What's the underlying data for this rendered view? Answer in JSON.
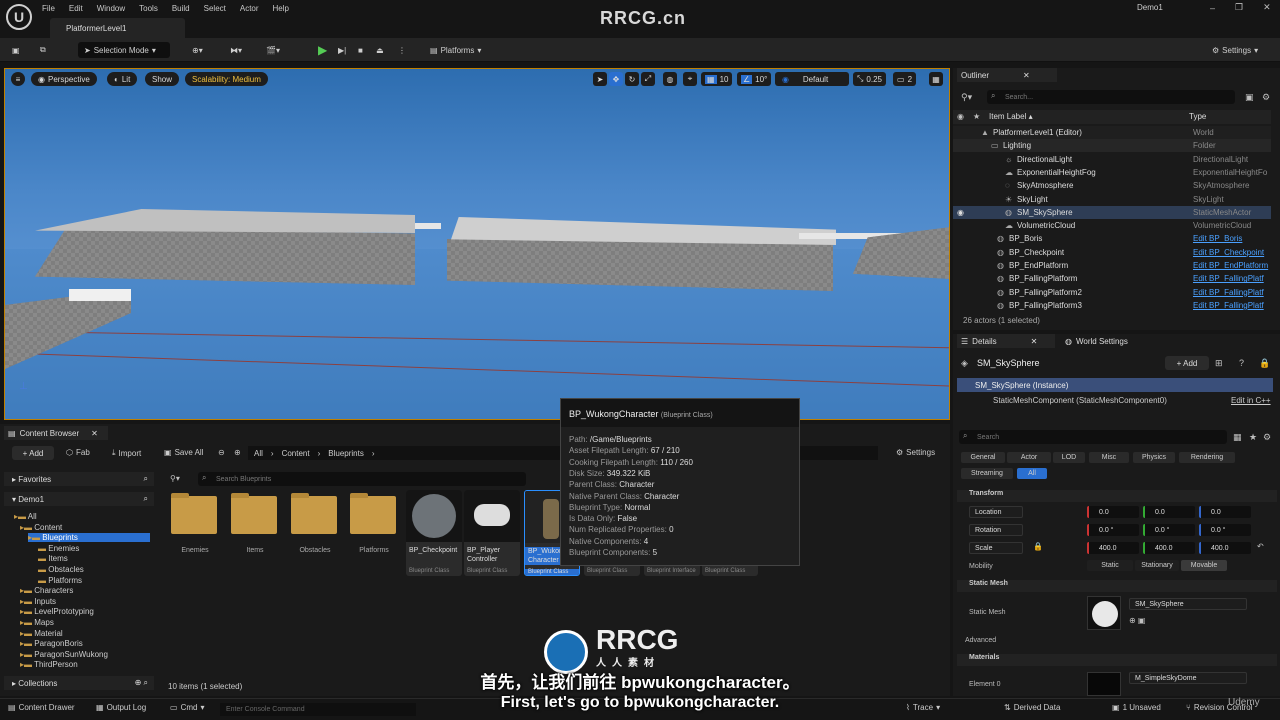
{
  "app": {
    "menu": [
      "File",
      "Edit",
      "Window",
      "Tools",
      "Build",
      "Select",
      "Actor",
      "Help"
    ],
    "level_tab": "PlatformerLevel1",
    "project": "Demo1",
    "logo_icon": "unreal-logo-icon"
  },
  "toolbar": {
    "selection_mode": "Selection Mode",
    "platforms": "Platforms",
    "settings": "Settings"
  },
  "viewport": {
    "perspective": "Perspective",
    "lit": "Lit",
    "show": "Show",
    "scalability": "Scalability: Medium",
    "grid": "10",
    "angle": "10°",
    "default": "Default",
    "scale": "0.25",
    "cam": "2"
  },
  "outliner": {
    "title": "Outliner",
    "search_placeholder": "Search...",
    "col_label": "Item Label ▴",
    "col_type": "Type",
    "rows": [
      {
        "label": "PlatformerLevel1 (Editor)",
        "type": "World",
        "link": false
      },
      {
        "label": "Lighting",
        "type": "Folder",
        "link": false
      },
      {
        "label": "DirectionalLight",
        "type": "DirectionalLight",
        "link": false
      },
      {
        "label": "ExponentialHeightFog",
        "type": "ExponentialHeightFo",
        "link": false
      },
      {
        "label": "SkyAtmosphere",
        "type": "SkyAtmosphere",
        "link": false
      },
      {
        "label": "SkyLight",
        "type": "SkyLight",
        "link": false
      },
      {
        "label": "SM_SkySphere",
        "type": "StaticMeshActor",
        "link": false
      },
      {
        "label": "VolumetricCloud",
        "type": "VolumetricCloud",
        "link": false
      },
      {
        "label": "BP_Boris",
        "type": "Edit BP_Boris",
        "link": true
      },
      {
        "label": "BP_Checkpoint",
        "type": "Edit BP_Checkpoint",
        "link": true
      },
      {
        "label": "BP_EndPlatform",
        "type": "Edit BP_EndPlatform",
        "link": true
      },
      {
        "label": "BP_FallingPlatform",
        "type": "Edit BP_FallingPlatf",
        "link": true
      },
      {
        "label": "BP_FallingPlatform2",
        "type": "Edit BP_FallingPlatf",
        "link": true
      },
      {
        "label": "BP_FallingPlatform3",
        "type": "Edit BP_FallingPlatf",
        "link": true
      }
    ],
    "status": "26 actors (1 selected)"
  },
  "details": {
    "tab": "Details",
    "tab2": "World Settings",
    "actor_name": "SM_SkySphere",
    "add_label": "+ Add",
    "instance": "SM_SkySphere (Instance)",
    "component": "StaticMeshComponent (StaticMeshComponent0)",
    "edit_cpp": "Edit in C++",
    "search_placeholder": "Search",
    "categories": [
      "General",
      "Actor",
      "LOD",
      "Misc",
      "Physics",
      "Rendering",
      "Streaming",
      "All"
    ],
    "transform_title": "Transform",
    "location_label": "Location",
    "location": [
      "0.0",
      "0.0",
      "0.0"
    ],
    "rotation_label": "Rotation",
    "rotation": [
      "0.0 °",
      "0.0 °",
      "0.0 °"
    ],
    "scale_label": "Scale",
    "scale": [
      "400.0",
      "400.0",
      "400.0"
    ],
    "mobility_label": "Mobility",
    "mobility": [
      "Static",
      "Stationary",
      "Movable"
    ],
    "static_mesh_title": "Static Mesh",
    "static_mesh_label": "Static Mesh",
    "static_mesh_value": "SM_SkySphere",
    "advanced": "Advanced",
    "materials_title": "Materials",
    "element0_label": "Element 0",
    "element0_value": "M_SimpleSkyDome"
  },
  "content_browser": {
    "title": "Content Browser",
    "add": "+ Add",
    "fab": "Fab",
    "import": "Import",
    "save_all": "Save All",
    "path": [
      "All",
      "Content",
      "Blueprints"
    ],
    "settings": "Settings",
    "favorites": "Favorites",
    "project": "Demo1",
    "search_placeholder": "Search Blueprints",
    "tree": [
      "All",
      "Content",
      "Blueprints",
      "Enemies",
      "Items",
      "Obstacles",
      "Platforms",
      "Characters",
      "Inputs",
      "LevelPrototyping",
      "Maps",
      "Material",
      "ParagonBoris",
      "ParagonSunWukong",
      "ThirdPerson"
    ],
    "collections": "Collections",
    "folders": [
      "Enemies",
      "Items",
      "Obstacles",
      "Platforms"
    ],
    "assets": [
      {
        "name": "BP_Checkpoint",
        "class": "Blueprint Class"
      },
      {
        "name": "BP_Player Controller",
        "class": "Blueprint Class"
      },
      {
        "name": "BP_Wukong Character",
        "class": "Blueprint Class"
      },
      {
        "name": "",
        "class": "Blueprint Class"
      },
      {
        "name": "",
        "class": "Blueprint Interface"
      },
      {
        "name": "",
        "class": "Blueprint Class"
      }
    ],
    "status": "10 items (1 selected)"
  },
  "tooltip": {
    "title": "BP_WukongCharacter",
    "subtitle": "(Blueprint Class)",
    "lines": [
      {
        "k": "Path:",
        "v": "/Game/Blueprints"
      },
      {
        "k": "Asset Filepath Length:",
        "v": "67 / 210"
      },
      {
        "k": "Cooking Filepath Length:",
        "v": "110 / 260"
      },
      {
        "k": "Disk Size:",
        "v": "349.322 KiB"
      },
      {
        "k": "Parent Class:",
        "v": "Character"
      },
      {
        "k": "Native Parent Class:",
        "v": "Character"
      },
      {
        "k": "Blueprint Type:",
        "v": "Normal"
      },
      {
        "k": "Is Data Only:",
        "v": "False"
      },
      {
        "k": "Num Replicated Properties:",
        "v": "0"
      },
      {
        "k": "Native Components:",
        "v": "4"
      },
      {
        "k": "Blueprint Components:",
        "v": "5"
      }
    ]
  },
  "statusbar": {
    "content_drawer": "Content Drawer",
    "output_log": "Output Log",
    "cmd": "Cmd",
    "console_placeholder": "Enter Console Command",
    "trace": "Trace",
    "derived_data": "Derived Data",
    "unsaved": "1 Unsaved",
    "revision": "Revision Control"
  },
  "subtitles": {
    "zh": "首先，让我们前往 bpwukongcharacter。",
    "en": "First, let's go to bpwukongcharacter."
  },
  "watermarks": {
    "top": "RRCG.cn",
    "center": "RRCG",
    "center_sub": "人人素材",
    "udemy": "Udemy"
  }
}
